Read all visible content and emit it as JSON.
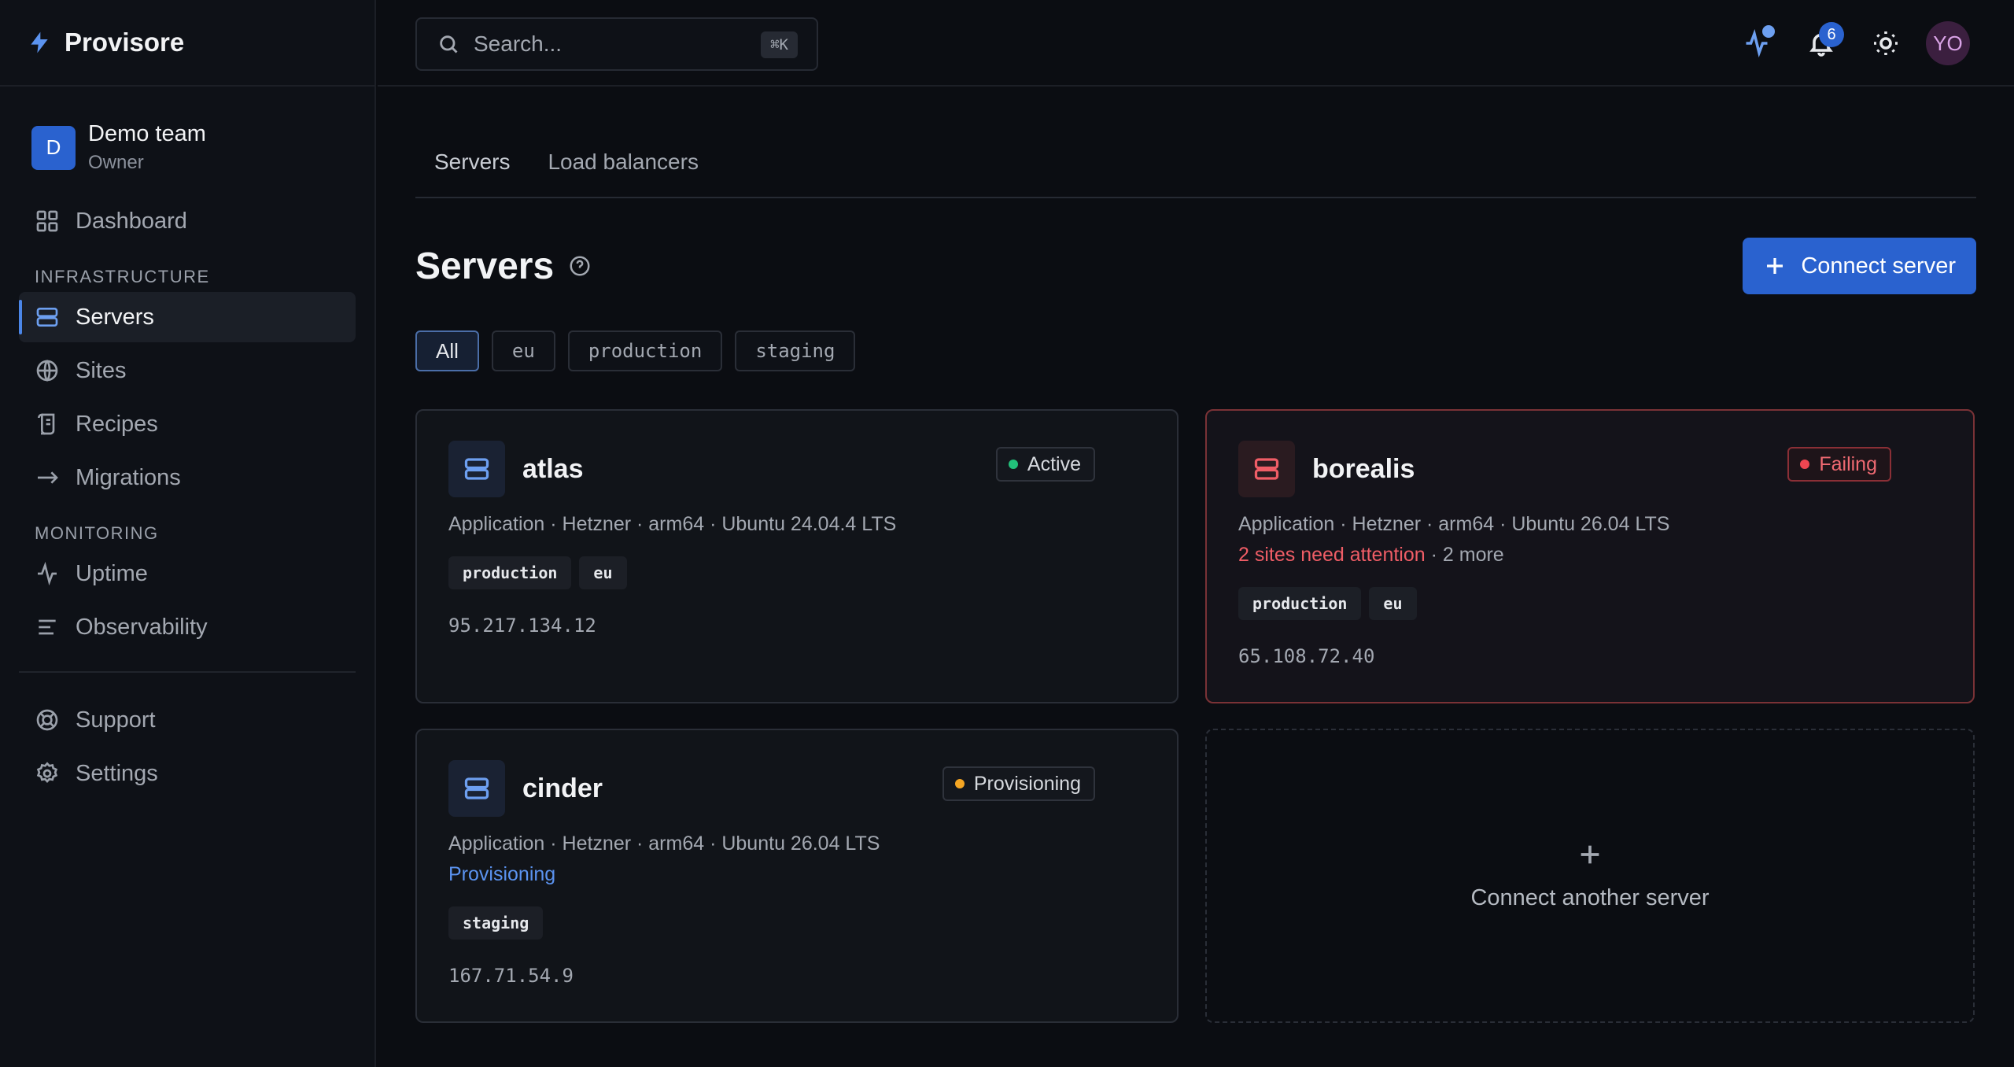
{
  "brand": {
    "name": "Provisore"
  },
  "team": {
    "initial": "D",
    "name": "Demo team",
    "role": "Owner"
  },
  "nav": {
    "dashboard": "Dashboard",
    "section_infrastructure": "INFRASTRUCTURE",
    "servers": "Servers",
    "sites": "Sites",
    "recipes": "Recipes",
    "migrations": "Migrations",
    "section_monitoring": "MONITORING",
    "uptime": "Uptime",
    "observability": "Observability",
    "support": "Support",
    "settings": "Settings"
  },
  "search": {
    "placeholder": "Search...",
    "shortcut": "⌘K"
  },
  "topbar": {
    "notifications_count": "6",
    "user_initials": "YO"
  },
  "tabs": [
    "Servers",
    "Load balancers"
  ],
  "page": {
    "title": "Servers",
    "connect_label": "Connect server"
  },
  "filters": [
    "All",
    "eu",
    "production",
    "staging"
  ],
  "servers": [
    {
      "name": "atlas",
      "status": "Active",
      "status_color": "#22c07a",
      "meta": "Application · Hetzner · arm64 · Ubuntu 24.04.4 LTS",
      "tags": [
        "production",
        "eu"
      ],
      "ip": "95.217.134.12"
    },
    {
      "name": "borealis",
      "status": "Failing",
      "status_color": "#ef4651",
      "meta": "Application · Hetzner · arm64 · Ubuntu 26.04 LTS",
      "note_alert": "2 sites need attention",
      "note_more": " · 2 more",
      "tags": [
        "production",
        "eu"
      ],
      "ip": "65.108.72.40"
    },
    {
      "name": "cinder",
      "status": "Provisioning",
      "status_color": "#f5a623",
      "meta": "Application · Hetzner · arm64 · Ubuntu 26.04 LTS",
      "note_progress": "Provisioning",
      "tags": [
        "staging"
      ],
      "ip": "167.71.54.9"
    }
  ],
  "add_card": {
    "label": "Connect another server"
  },
  "colors": {
    "accent": "#2a62cf",
    "danger": "#ef4651",
    "success": "#22c07a",
    "warning": "#f5a623"
  }
}
